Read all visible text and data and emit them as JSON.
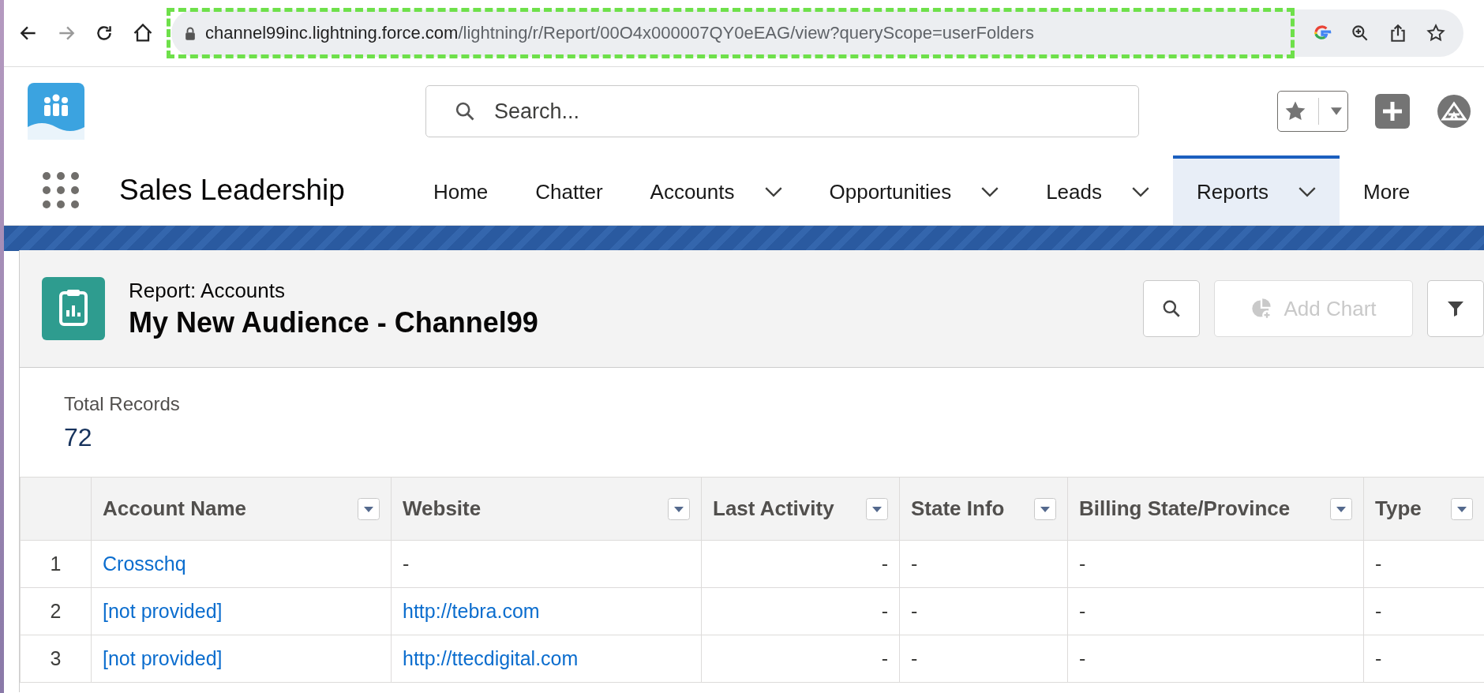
{
  "browser": {
    "back_disabled": false,
    "forward_disabled": true,
    "url_host": "channel99inc.lightning.force.com",
    "url_path": "/lightning/r/Report/00O4x000007QY0eEAG/view?queryScope=userFolders"
  },
  "header": {
    "search": {
      "placeholder": "Search..."
    }
  },
  "nav": {
    "app_name": "Sales Leadership",
    "items": [
      {
        "label": "Home",
        "dropdown": false,
        "selected": false
      },
      {
        "label": "Chatter",
        "dropdown": false,
        "selected": false
      },
      {
        "label": "Accounts",
        "dropdown": true,
        "selected": false
      },
      {
        "label": "Opportunities",
        "dropdown": true,
        "selected": false
      },
      {
        "label": "Leads",
        "dropdown": true,
        "selected": false
      },
      {
        "label": "Reports",
        "dropdown": true,
        "selected": true
      },
      {
        "label": "More",
        "dropdown": false,
        "selected": false
      }
    ]
  },
  "report": {
    "type_label": "Report: Accounts",
    "title": "My New Audience - Channel99",
    "add_chart": {
      "label": "Add Chart",
      "disabled": true
    }
  },
  "summary": {
    "label": "Total Records",
    "value": "72"
  },
  "table": {
    "columns": [
      {
        "label": "Account Name"
      },
      {
        "label": "Website"
      },
      {
        "label": "Last Activity"
      },
      {
        "label": "State Info"
      },
      {
        "label": "Billing State/Province"
      },
      {
        "label": "Type"
      }
    ],
    "rows": [
      {
        "number": "1",
        "cells": [
          {
            "text": "Crosschq",
            "link": true
          },
          {
            "text": "-",
            "link": false
          },
          {
            "text": "-",
            "link": false
          },
          {
            "text": "-",
            "link": false
          },
          {
            "text": "-",
            "link": false
          },
          {
            "text": "-",
            "link": false
          }
        ]
      },
      {
        "number": "2",
        "cells": [
          {
            "text": "[not provided]",
            "link": true
          },
          {
            "text": "http://tebra.com",
            "link": true
          },
          {
            "text": "-",
            "link": false
          },
          {
            "text": "-",
            "link": false
          },
          {
            "text": "-",
            "link": false
          },
          {
            "text": "-",
            "link": false
          }
        ]
      },
      {
        "number": "3",
        "cells": [
          {
            "text": "[not provided]",
            "link": true
          },
          {
            "text": "http://ttecdigital.com",
            "link": true
          },
          {
            "text": "-",
            "link": false
          },
          {
            "text": "-",
            "link": false
          },
          {
            "text": "-",
            "link": false
          },
          {
            "text": "-",
            "link": false
          }
        ]
      }
    ]
  }
}
